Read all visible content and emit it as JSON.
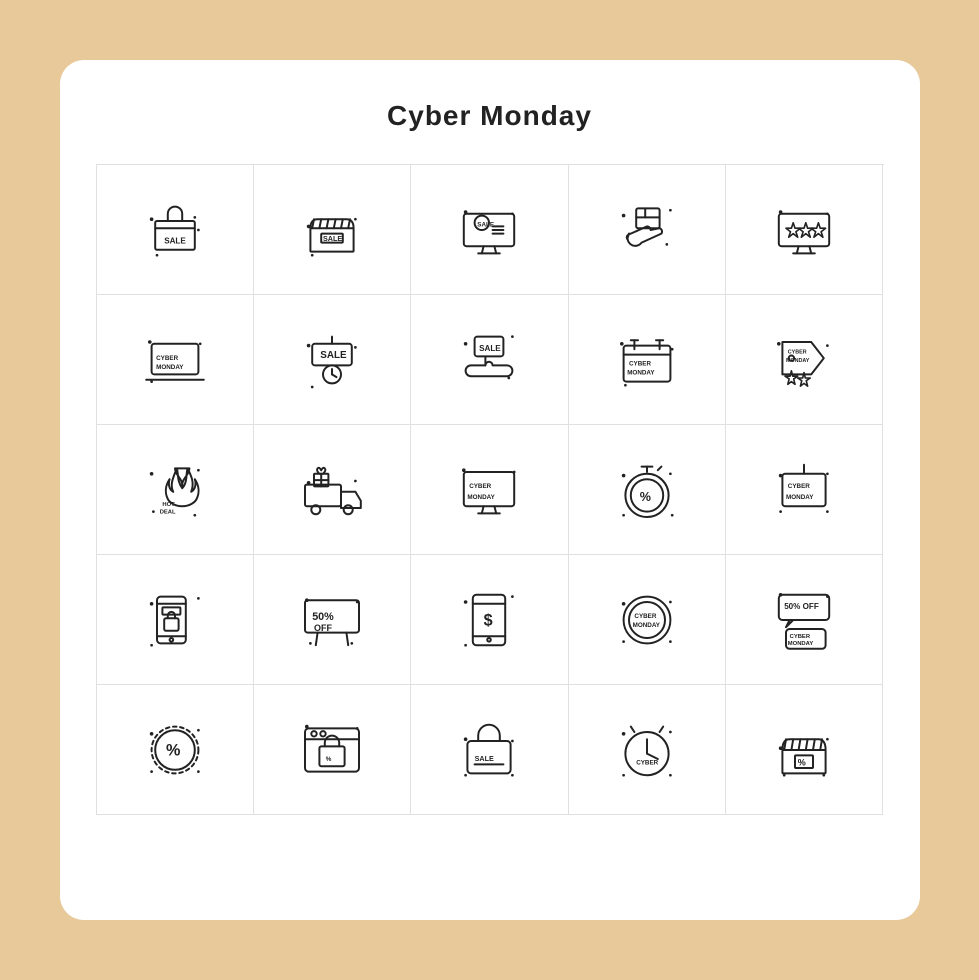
{
  "page": {
    "title": "Cyber Monday",
    "background_color": "#E8C99A",
    "card_color": "#ffffff"
  },
  "icons": [
    {
      "id": "sale-box",
      "label": "Sale Box"
    },
    {
      "id": "sale-store",
      "label": "Sale Store"
    },
    {
      "id": "sale-monitor",
      "label": "Sale Monitor"
    },
    {
      "id": "delivery-hand",
      "label": "Delivery Hand"
    },
    {
      "id": "rating-monitor",
      "label": "Rating Monitor"
    },
    {
      "id": "cyber-monday-laptop",
      "label": "Cyber Monday Laptop"
    },
    {
      "id": "sale-sign-clock",
      "label": "Sale Sign Clock"
    },
    {
      "id": "sale-hand",
      "label": "Sale Hand"
    },
    {
      "id": "cyber-monday-calendar",
      "label": "Cyber Monday Calendar"
    },
    {
      "id": "cyber-monday-tag-stars",
      "label": "Cyber Monday Tag Stars"
    },
    {
      "id": "hot-deal",
      "label": "Hot Deal"
    },
    {
      "id": "delivery-truck",
      "label": "Delivery Truck"
    },
    {
      "id": "cyber-monday-screen",
      "label": "Cyber Monday Screen"
    },
    {
      "id": "timer-percent",
      "label": "Timer Percent"
    },
    {
      "id": "cyber-monday-hanging-tag",
      "label": "Cyber Monday Hanging Tag"
    },
    {
      "id": "mobile-shop-bag",
      "label": "Mobile Shop Bag"
    },
    {
      "id": "50-off-sign",
      "label": "50% Off Sign"
    },
    {
      "id": "mobile-dollar",
      "label": "Mobile Dollar"
    },
    {
      "id": "cyber-monday-circle",
      "label": "Cyber Monday Circle"
    },
    {
      "id": "50-off-speech",
      "label": "50% Off Speech Bubble"
    },
    {
      "id": "percent-badge",
      "label": "Percent Badge"
    },
    {
      "id": "browser-shopping",
      "label": "Browser Shopping"
    },
    {
      "id": "sale-bag",
      "label": "Sale Bag"
    },
    {
      "id": "cyber-clock",
      "label": "Cyber Clock"
    },
    {
      "id": "store-percent",
      "label": "Store Percent"
    }
  ]
}
